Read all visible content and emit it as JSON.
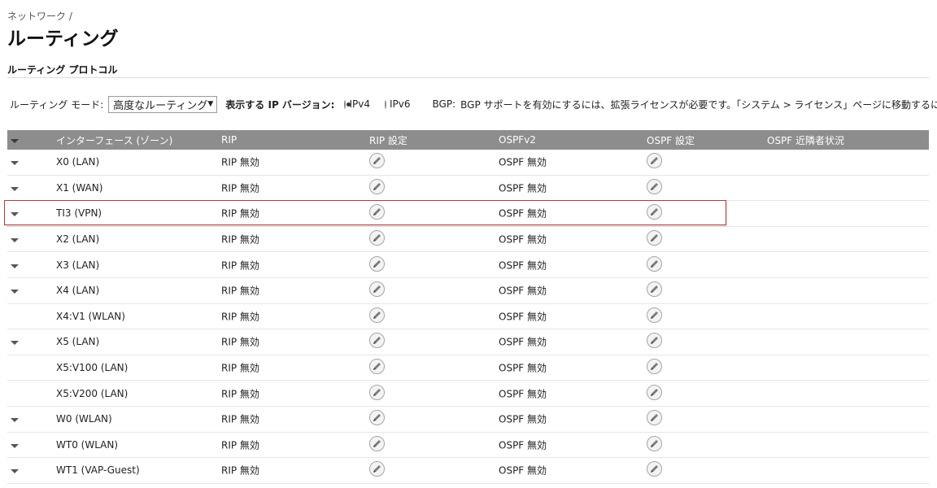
{
  "breadcrumb": "ネットワーク /",
  "page_title": "ルーティング",
  "section_title": "ルーティング プロトコル",
  "controls": {
    "mode_label": "ルーティング モード:",
    "mode_value": "高度なルーティング",
    "ip_version_label": "表示する IP バージョン:",
    "ipv4": "IPv4",
    "ipv6": "IPv6",
    "selected_ip": "IPv4",
    "bgp_label": "BGP:",
    "bgp_message": "BGP サポートを有効にするには、拡張ライセンスが必要です。「システム > ライセンス」ページに移動するには"
  },
  "table": {
    "headers": [
      "インターフェース (ゾーン)",
      "RIP",
      "RIP 設定",
      "OSPFv2",
      "OSPF 設定",
      "OSPF 近隣者状況"
    ],
    "rows": [
      {
        "iface": "X0 (LAN)",
        "rip": "RIP 無効",
        "ospf": "OSPF 無効",
        "expandable": true
      },
      {
        "iface": "X1 (WAN)",
        "rip": "RIP 無効",
        "ospf": "OSPF 無効",
        "expandable": true
      },
      {
        "iface": "TI3 (VPN)",
        "rip": "RIP 無効",
        "ospf": "OSPF 無効",
        "expandable": true
      },
      {
        "iface": "X2 (LAN)",
        "rip": "RIP 無効",
        "ospf": "OSPF 無効",
        "expandable": true
      },
      {
        "iface": "X3 (LAN)",
        "rip": "RIP 無効",
        "ospf": "OSPF 無効",
        "expandable": true
      },
      {
        "iface": "X4 (LAN)",
        "rip": "RIP 無効",
        "ospf": "OSPF 無効",
        "expandable": true
      },
      {
        "iface": "X4:V1 (WLAN)",
        "rip": "RIP 無効",
        "ospf": "OSPF 無効",
        "expandable": false
      },
      {
        "iface": "X5 (LAN)",
        "rip": "RIP 無効",
        "ospf": "OSPF 無効",
        "expandable": true
      },
      {
        "iface": "X5:V100 (LAN)",
        "rip": "RIP 無効",
        "ospf": "OSPF 無効",
        "expandable": false
      },
      {
        "iface": "X5:V200 (LAN)",
        "rip": "RIP 無効",
        "ospf": "OSPF 無効",
        "expandable": false
      },
      {
        "iface": "W0 (WLAN)",
        "rip": "RIP 無効",
        "ospf": "OSPF 無効",
        "expandable": true
      },
      {
        "iface": "WT0 (WLAN)",
        "rip": "RIP 無効",
        "ospf": "OSPF 無効",
        "expandable": true
      },
      {
        "iface": "WT1 (VAP-Guest)",
        "rip": "RIP 無効",
        "ospf": "OSPF 無効",
        "expandable": true
      }
    ]
  },
  "highlight_row": "TI3 (VPN)",
  "colors": {
    "header_bg": "#8d8d8d",
    "highlight_border": "#b33b3b"
  }
}
